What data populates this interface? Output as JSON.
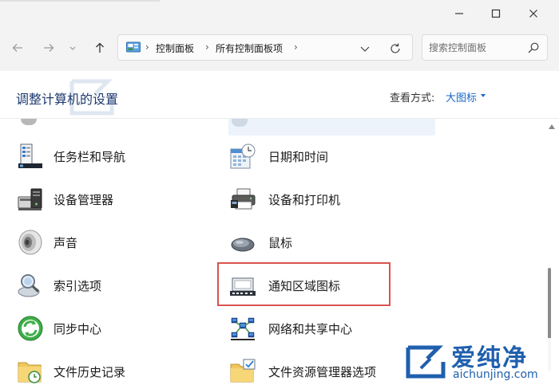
{
  "window": {
    "controls": {
      "minimize": "minimize",
      "maximize": "maximize",
      "close": "close"
    }
  },
  "nav": {
    "breadcrumbs": [
      "控制面板",
      "所有控制面板项"
    ],
    "separator": "›",
    "search_placeholder": "搜索控制面板"
  },
  "header": {
    "title": "调整计算机的设置",
    "view_by_label": "查看方式:",
    "view_by_value": "大图标"
  },
  "items_left": [
    {
      "label": "任务栏和导航",
      "icon": "taskbar-icon"
    },
    {
      "label": "设备管理器",
      "icon": "device-manager-icon"
    },
    {
      "label": "声音",
      "icon": "speaker-icon"
    },
    {
      "label": "索引选项",
      "icon": "indexing-icon"
    },
    {
      "label": "同步中心",
      "icon": "sync-center-icon"
    },
    {
      "label": "文件历史记录",
      "icon": "file-history-icon"
    }
  ],
  "items_right": [
    {
      "label": "日期和时间",
      "icon": "calendar-clock-icon"
    },
    {
      "label": "设备和打印机",
      "icon": "printer-icon"
    },
    {
      "label": "鼠标",
      "icon": "mouse-icon"
    },
    {
      "label": "通知区域图标",
      "icon": "notification-area-icon",
      "highlighted": true
    },
    {
      "label": "网络和共享中心",
      "icon": "network-icon"
    },
    {
      "label": "文件资源管理器选项",
      "icon": "folder-options-icon"
    }
  ],
  "watermark": {
    "brand": "爱纯净",
    "site": "aichunjing.com"
  },
  "colors": {
    "accent": "#1a66c5",
    "highlight_border": "#d9534f",
    "title_text": "#1e3a6e"
  }
}
